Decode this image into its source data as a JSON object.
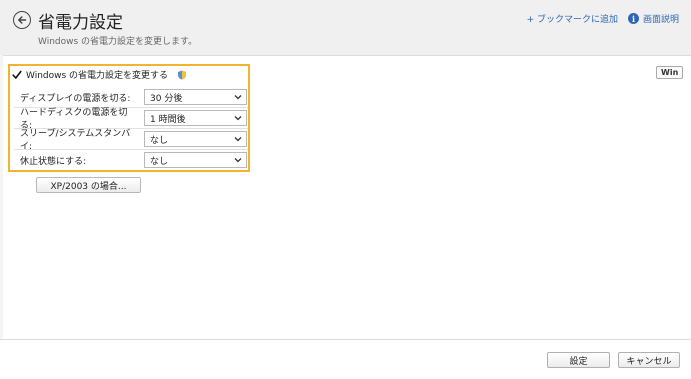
{
  "header": {
    "title": "省電力設定",
    "subtitle": "Windows の省電力設定を変更します。",
    "bookmark_link": "+ ブックマークに追加",
    "help_link": "画面説明"
  },
  "badge": "Win",
  "power": {
    "enable_label": "Windows の省電力設定を変更する",
    "enabled": true,
    "settings": [
      {
        "label": "ディスプレイの電源を切る:",
        "value": "30 分後"
      },
      {
        "label": "ハードディスクの電源を切る:",
        "value": "1 時間後"
      },
      {
        "label": "スリープ/システムスタンバイ:",
        "value": "なし"
      },
      {
        "label": "休止状態にする:",
        "value": "なし"
      }
    ],
    "xp_button": "XP/2003 の場合..."
  },
  "footer": {
    "ok_label": "設定",
    "cancel_label": "キャンセル"
  },
  "colors": {
    "accent": "#f2b32f",
    "link": "#2f66b3"
  },
  "icons": [
    "back-arrow-icon",
    "info-icon",
    "checkmark-icon",
    "shield-icon",
    "chevron-down-icon"
  ]
}
